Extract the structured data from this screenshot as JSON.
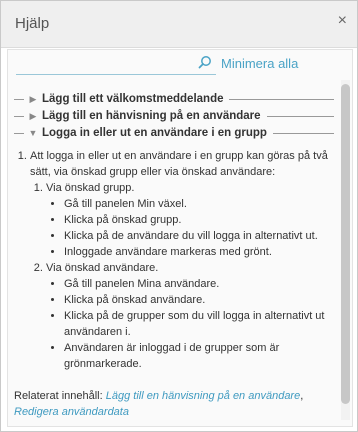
{
  "dialog": {
    "title": "Hjälp",
    "close_glyph": "×"
  },
  "search": {
    "value": "",
    "placeholder": "",
    "icon": "search-icon",
    "minimize_label": "Minimera alla"
  },
  "sections": [
    {
      "label": "Lägg till ett välkomstmeddelande",
      "expanded": false
    },
    {
      "label": "Lägg till en hänvisning på en användare",
      "expanded": false
    },
    {
      "label": "Logga in eller ut en användare i en grupp",
      "expanded": true
    }
  ],
  "content": {
    "intro": "Att logga in eller ut en användare i en grupp kan göras på två sätt, via önskad grupp eller via önskad användare:",
    "methods": [
      {
        "label": "Via önskad grupp.",
        "steps": [
          "Gå till panelen Min växel.",
          "Klicka på önskad grupp.",
          "Klicka på de användare du vill logga in alternativt ut.",
          "Inloggade användare markeras med grönt."
        ]
      },
      {
        "label": "Via önskad användare.",
        "steps": [
          "Gå till panelen Mina användare.",
          "Klicka på önskad användare.",
          "Klicka på de grupper som du vill logga in alternativt ut användaren i.",
          "Användaren är inloggad i de grupper som är grönmarkerade."
        ]
      }
    ]
  },
  "related": {
    "prefix": "Relaterat innehåll: ",
    "links": [
      "Lägg till en hänvisning på en användare",
      "Redigera användardata"
    ],
    "separator": ","
  },
  "colors": {
    "accent": "#4aa3c6",
    "link": "#3f9ac0"
  }
}
